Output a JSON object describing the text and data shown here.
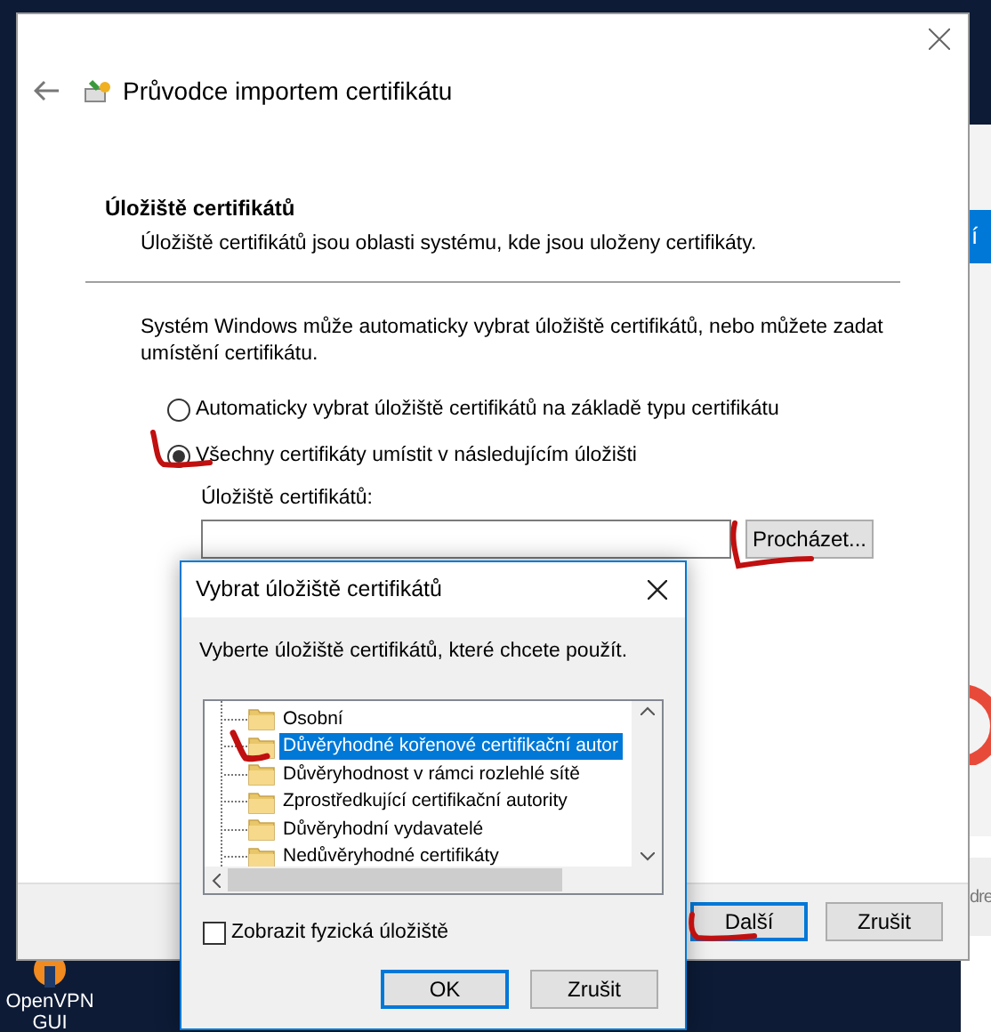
{
  "background": {
    "side_button_text": "í",
    "side_text": "dre",
    "desktop_icon": {
      "label_lines": [
        "OpenVPN",
        "GUI"
      ]
    }
  },
  "wizard": {
    "title": "Průvodce importem certifikátu",
    "header": {
      "title": "Úložiště certifikátů",
      "subtitle": "Úložiště certifikátů jsou oblasti systému, kde jsou uloženy certifikáty."
    },
    "description": "Systém Windows může automaticky vybrat úložiště certifikátů, nebo můžete zadat umístění certifikátu.",
    "options": [
      {
        "label": "Automaticky vybrat úložiště certifikátů na základě typu certifikátu",
        "selected": false
      },
      {
        "label": "Všechny certifikáty umístit v následujícím úložišti",
        "selected": true
      }
    ],
    "store_label": "Úložiště certifikátů:",
    "browse_button": "Procházet...",
    "buttons": [
      {
        "label": "Další",
        "default": true
      },
      {
        "label": "Zrušit",
        "default": false
      }
    ]
  },
  "dialog": {
    "title": "Vybrat úložiště certifikátů",
    "prompt": "Vyberte úložiště certifikátů, které chcete použít.",
    "stores": [
      {
        "label": "Osobní",
        "selected": false
      },
      {
        "label": "Důvěryhodné kořenové certifikační autor",
        "selected": true
      },
      {
        "label": "Důvěryhodnost v rámci rozlehlé sítě",
        "selected": false
      },
      {
        "label": "Zprostředkující certifikační autority",
        "selected": false
      },
      {
        "label": "Důvěryhodní vydavatelé",
        "selected": false
      },
      {
        "label": "Nedůvěryhodné certifikáty",
        "selected": false
      }
    ],
    "show_physical": {
      "label": "Zobrazit fyzická úložiště",
      "checked": false
    },
    "buttons": [
      {
        "label": "OK",
        "default": true
      },
      {
        "label": "Zrušit",
        "default": false
      }
    ]
  }
}
